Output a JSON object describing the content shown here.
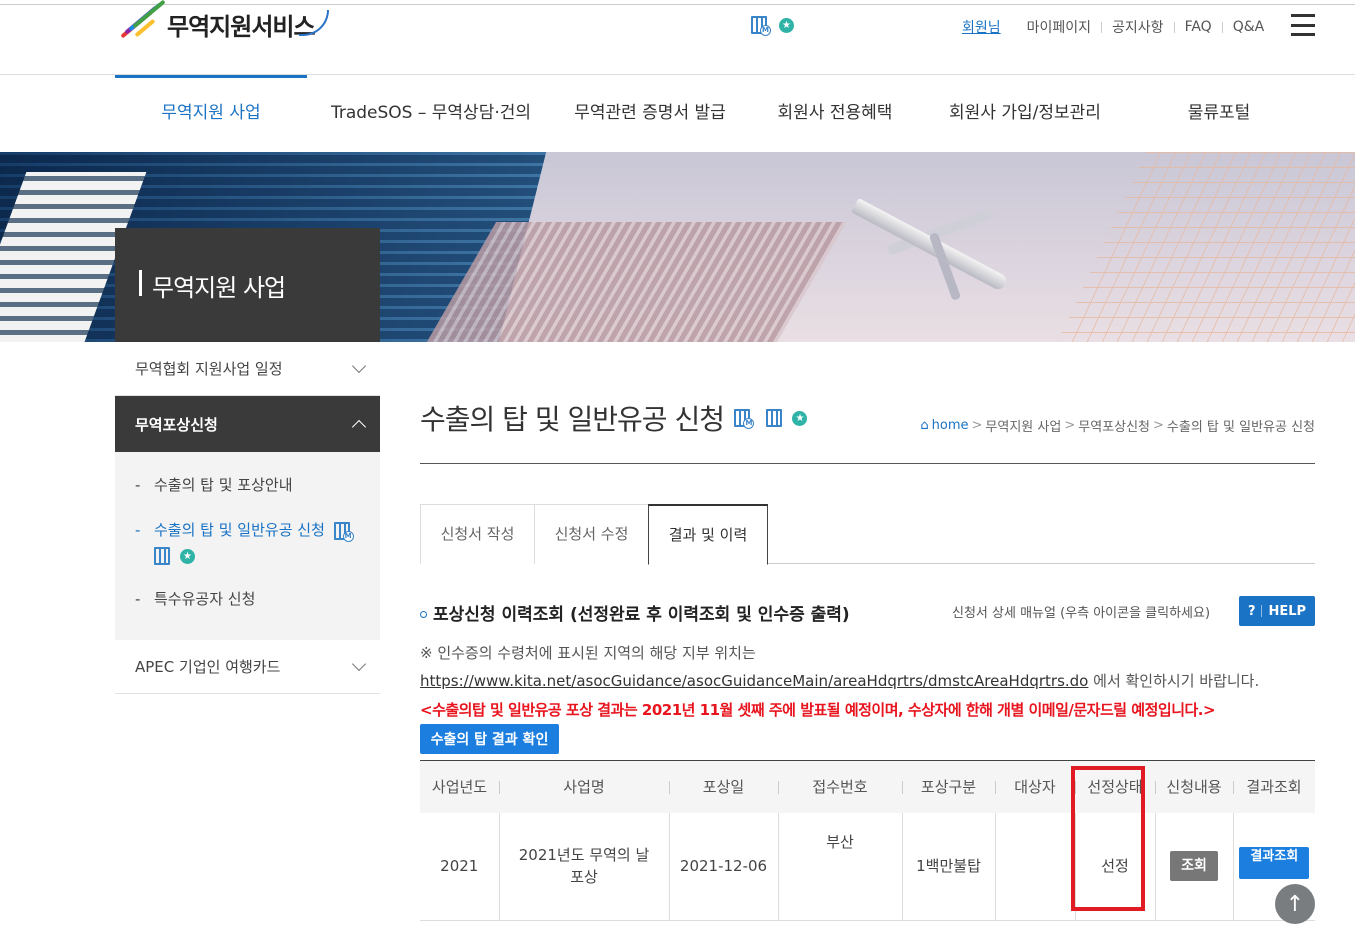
{
  "header": {
    "logo_text": "무역지원서비스",
    "util": {
      "member": "회원님",
      "mypage": "마이페이지",
      "notice": "공지사항",
      "faq": "FAQ",
      "qa": "Q&A"
    }
  },
  "gnb": [
    "무역지원 사업",
    "TradeSOS – 무역상담·건의",
    "무역관련 증명서 발급",
    "회원사 전용혜택",
    "회원사 가입/정보관리",
    "물류포털"
  ],
  "section_title": "무역지원 사업",
  "sidebar": {
    "items": [
      {
        "label": "무역협회 지원사업 일정"
      },
      {
        "label": "무역포상신청"
      },
      {
        "label": "APEC 기업인 여행카드"
      }
    ],
    "sub_items": [
      {
        "label": "수출의 탑 및 포상안내"
      },
      {
        "label": "수출의 탑 및 일반유공 신청"
      },
      {
        "label": "특수유공자 신청"
      }
    ],
    "dash": "-"
  },
  "page": {
    "title": "수출의 탑 및 일반유공 신청",
    "breadcrumb": [
      "home",
      "무역지원 사업",
      "무역포상신청",
      "수출의 탑 및 일반유공 신청"
    ]
  },
  "tabs": [
    "신청서 작성",
    "신청서 수정",
    "결과 및 이력"
  ],
  "section": {
    "heading": "포상신청 이력조회 (선정완료 후 이력조회 및 인수증 출력)",
    "help_note": "신청서 상세 매뉴얼 (우측 아이콘을 클릭하세요)",
    "help_q": "?",
    "help_label": "HELP"
  },
  "notices": {
    "line1": "※ 인수증의 수령처에 표시된 지역의 해당 지부 위치는",
    "link": "https://www.kita.net/asocGuidance/asocGuidanceMain/areaHdqrtrs/dmstcAreaHdqrtrs.do",
    "line2_suffix": " 에서 확인하시기 바랍니다.",
    "red": "<수출의탑 및 일반유공 포상 결과는 2021년 11월 셋째 주에 발표될 예정이며, 수상자에 한해 개별 이메일/문자드릴 예정입니다.>"
  },
  "result_button": "수출의 탑 결과 확인",
  "table": {
    "headers": [
      "사업년도",
      "사업명",
      "포상일",
      "접수번호",
      "포상구분",
      "대상자",
      "선정상태",
      "신청내용",
      "결과조회"
    ],
    "rows": [
      {
        "year": "2021",
        "name": "2021년도 무역의 날 포상",
        "date": "2021-12-06",
        "receipt": "부산",
        "award_type": "1백만불탑",
        "target": "",
        "status": "선정",
        "view_btn": "조회",
        "result_btn": "결과조회"
      }
    ]
  },
  "colors": {
    "accent": "#1a73c4",
    "alert": "#e8141e",
    "highlight_box": "#e01b24"
  },
  "icons": {
    "mobile_building": "building-m-icon",
    "building": "building-icon",
    "star": "star-badge-icon",
    "home": "⌂",
    "up_arrow": "↑"
  }
}
